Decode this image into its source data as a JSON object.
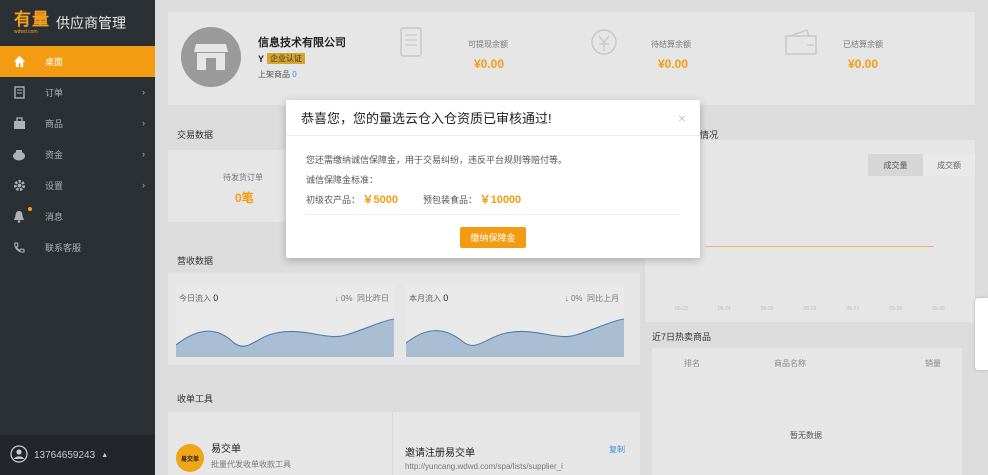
{
  "app": {
    "logo_text": "有量",
    "logo_sub": "wdwd.com",
    "title": "供应商管理"
  },
  "sidebar": {
    "items": [
      {
        "label": "桌面",
        "icon": "home-icon",
        "active": true
      },
      {
        "label": "订单",
        "icon": "order-icon"
      },
      {
        "label": "商品",
        "icon": "goods-icon"
      },
      {
        "label": "资金",
        "icon": "money-icon"
      },
      {
        "label": "设置",
        "icon": "gear-icon"
      },
      {
        "label": "消息",
        "icon": "bell-icon"
      },
      {
        "label": "联系客服",
        "icon": "phone-icon"
      }
    ],
    "arrow": "›",
    "user_phone": "13764659243",
    "user_caret": "▲"
  },
  "company": {
    "name": "信息技术有限公司",
    "badge": "企业认证",
    "goods_label": "上架商品",
    "goods_count": "0"
  },
  "balances": [
    {
      "label": "可提现余额",
      "value": "¥0.00"
    },
    {
      "label": "待结算余额",
      "value": "¥0.00"
    },
    {
      "label": "已结算余额",
      "value": "¥0.00"
    }
  ],
  "trade": {
    "title": "交易数据",
    "pending_label": "待发货订单",
    "pending_value": "0笔"
  },
  "sales_title": "情况",
  "sales_tabs": [
    "成交量",
    "成交额"
  ],
  "dates": [
    "05-23",
    "05-24",
    "05-25",
    "05-26",
    "05-27",
    "05-28",
    "05-29"
  ],
  "revenue": {
    "title": "营收数据",
    "today_label": "今日流入",
    "today_value": "0",
    "today_change": "↓  0%",
    "today_compare": "同比昨日",
    "month_label": "本月流入",
    "month_value": "0",
    "month_change": "↓  0%",
    "month_compare": "同比上月"
  },
  "hot": {
    "title": "近7日热卖商品",
    "col_rank": "排名",
    "col_name": "商品名称",
    "col_sales": "销量",
    "empty": "暂无数据"
  },
  "tools": {
    "title": "收单工具",
    "yjd_name": "易交单",
    "yjd_desc": "批量代发收单收款工具",
    "yjd_logo": "易交单",
    "invite_title": "邀请注册易交单",
    "invite_url": "http://yuncang.wdwd.com/spa/lists/supplier_i",
    "copy_label": "复制"
  },
  "modal": {
    "title": "恭喜您，您的量选云仓入仓资质已审核通过!",
    "close": "×",
    "line1": "您还需缴纳诚信保障金，用于交易纠纷，违反平台规则等赔付等。",
    "line2": "诚信保障金标准：",
    "cat1_label": "初级农产品：",
    "cat1_price": "￥5000",
    "cat2_label": "预包装食品：",
    "cat2_price": "￥10000",
    "button": "缴纳保障金"
  },
  "colors": {
    "accent": "#f39c12",
    "sidebar": "#2b3035"
  }
}
